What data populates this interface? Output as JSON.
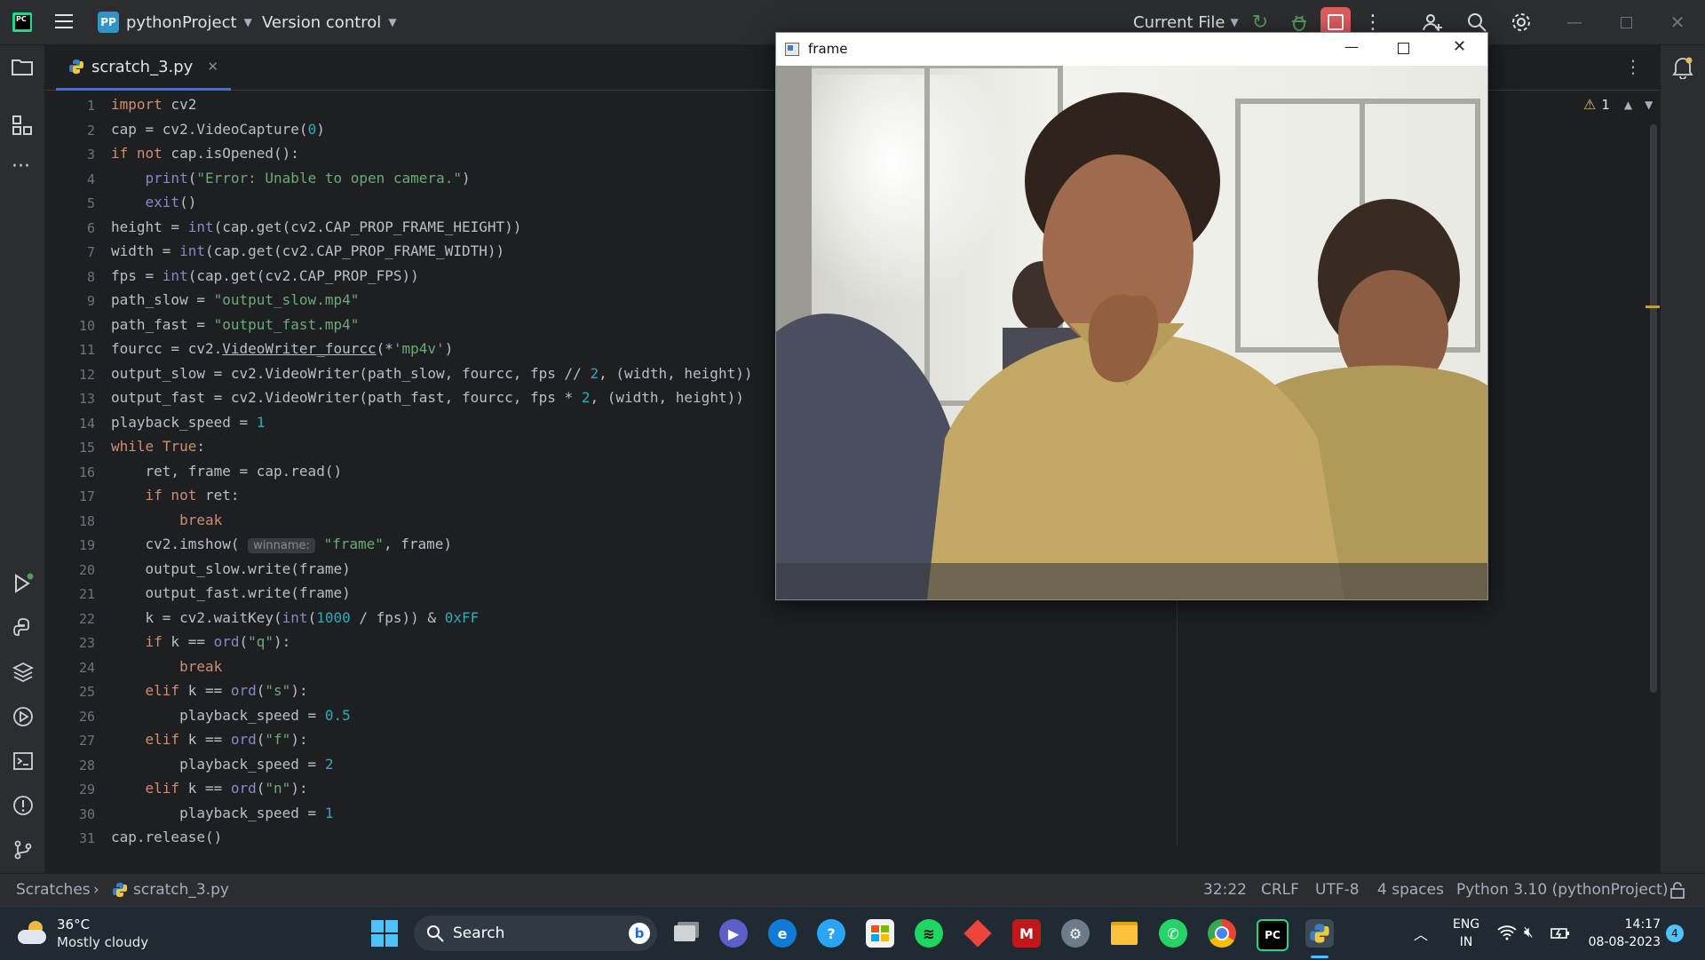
{
  "titlebar": {
    "project_badge": "PP",
    "project_name": "pythonProject",
    "vcs": "Version control",
    "run_config": "Current File"
  },
  "tab": {
    "name": "scratch_3.py"
  },
  "inspection": {
    "warnings": "1"
  },
  "code": [
    [
      {
        "t": "import",
        "c": "kw"
      },
      {
        "t": " cv2"
      }
    ],
    [
      {
        "t": "cap = cv2.VideoCapture("
      },
      {
        "t": "0",
        "c": "num"
      },
      {
        "t": ")"
      }
    ],
    [
      {
        "t": "if not",
        "c": "kw"
      },
      {
        "t": " cap.isOpened():"
      }
    ],
    [
      {
        "t": "    "
      },
      {
        "t": "print",
        "c": "bi"
      },
      {
        "t": "("
      },
      {
        "t": "\"Error: Unable to open camera.\"",
        "c": "str"
      },
      {
        "t": ")"
      }
    ],
    [
      {
        "t": "    "
      },
      {
        "t": "exit",
        "c": "bi"
      },
      {
        "t": "()"
      }
    ],
    [
      {
        "t": "height = "
      },
      {
        "t": "int",
        "c": "bi"
      },
      {
        "t": "(cap.get(cv2.CAP_PROP_FRAME_HEIGHT))"
      }
    ],
    [
      {
        "t": "width = "
      },
      {
        "t": "int",
        "c": "bi"
      },
      {
        "t": "(cap.get(cv2.CAP_PROP_FRAME_WIDTH))"
      }
    ],
    [
      {
        "t": "fps = "
      },
      {
        "t": "int",
        "c": "bi"
      },
      {
        "t": "(cap.get(cv2.CAP_PROP_FPS))"
      }
    ],
    [
      {
        "t": "path_slow = "
      },
      {
        "t": "\"output_slow.mp4\"",
        "c": "str"
      }
    ],
    [
      {
        "t": "path_fast = "
      },
      {
        "t": "\"output_fast.mp4\"",
        "c": "str"
      }
    ],
    [
      {
        "t": "fourcc = cv2."
      },
      {
        "t": "VideoWriter_fourcc",
        "u": true
      },
      {
        "t": "(*"
      },
      {
        "t": "'mp4v'",
        "c": "str"
      },
      {
        "t": ")"
      }
    ],
    [
      {
        "t": "output_slow = cv2.VideoWriter(path_slow, fourcc, fps // "
      },
      {
        "t": "2",
        "c": "num"
      },
      {
        "t": ", (width, height))"
      }
    ],
    [
      {
        "t": "output_fast = cv2.VideoWriter(path_fast, fourcc, fps * "
      },
      {
        "t": "2",
        "c": "num"
      },
      {
        "t": ", (width, height))"
      }
    ],
    [
      {
        "t": "playback_speed = "
      },
      {
        "t": "1",
        "c": "num"
      }
    ],
    [
      {
        "t": "while",
        "c": "kw"
      },
      {
        "t": " "
      },
      {
        "t": "True",
        "c": "kw"
      },
      {
        "t": ":"
      }
    ],
    [
      {
        "t": "    ret, frame = cap.read()"
      }
    ],
    [
      {
        "t": "    "
      },
      {
        "t": "if not",
        "c": "kw"
      },
      {
        "t": " ret:"
      }
    ],
    [
      {
        "t": "        "
      },
      {
        "t": "break",
        "c": "kw"
      }
    ],
    [
      {
        "t": "    cv2.imshow( "
      },
      {
        "t": "winname:",
        "c": "hint"
      },
      {
        "t": " "
      },
      {
        "t": "\"frame\"",
        "c": "str"
      },
      {
        "t": ", frame)"
      }
    ],
    [
      {
        "t": "    output_slow.write(frame)"
      }
    ],
    [
      {
        "t": "    output_fast.write(frame)"
      }
    ],
    [
      {
        "t": "    k = cv2.waitKey("
      },
      {
        "t": "int",
        "c": "bi"
      },
      {
        "t": "("
      },
      {
        "t": "1000",
        "c": "num"
      },
      {
        "t": " / fps)) & "
      },
      {
        "t": "0xFF",
        "c": "num"
      }
    ],
    [
      {
        "t": "    "
      },
      {
        "t": "if",
        "c": "kw"
      },
      {
        "t": " k == "
      },
      {
        "t": "ord",
        "c": "bi"
      },
      {
        "t": "("
      },
      {
        "t": "\"q\"",
        "c": "str"
      },
      {
        "t": "):"
      }
    ],
    [
      {
        "t": "        "
      },
      {
        "t": "break",
        "c": "kw"
      }
    ],
    [
      {
        "t": "    "
      },
      {
        "t": "elif",
        "c": "kw"
      },
      {
        "t": " k == "
      },
      {
        "t": "ord",
        "c": "bi"
      },
      {
        "t": "("
      },
      {
        "t": "\"s\"",
        "c": "str"
      },
      {
        "t": "):"
      }
    ],
    [
      {
        "t": "        playback_speed = "
      },
      {
        "t": "0.5",
        "c": "num"
      }
    ],
    [
      {
        "t": "    "
      },
      {
        "t": "elif",
        "c": "kw"
      },
      {
        "t": " k == "
      },
      {
        "t": "ord",
        "c": "bi"
      },
      {
        "t": "("
      },
      {
        "t": "\"f\"",
        "c": "str"
      },
      {
        "t": "):"
      }
    ],
    [
      {
        "t": "        playback_speed = "
      },
      {
        "t": "2",
        "c": "num"
      }
    ],
    [
      {
        "t": "    "
      },
      {
        "t": "elif",
        "c": "kw"
      },
      {
        "t": " k == "
      },
      {
        "t": "ord",
        "c": "bi"
      },
      {
        "t": "("
      },
      {
        "t": "\"n\"",
        "c": "str"
      },
      {
        "t": "):"
      }
    ],
    [
      {
        "t": "        playback_speed = "
      },
      {
        "t": "1",
        "c": "num"
      }
    ],
    [
      {
        "t": "cap.release()"
      }
    ]
  ],
  "frame_window": {
    "title": "frame"
  },
  "statusbar": {
    "breadcrumb_root": "Scratches",
    "breadcrumb_file": "scratch_3.py",
    "position": "32:22",
    "line_sep": "CRLF",
    "encoding": "UTF-8",
    "indent": "4 spaces",
    "interpreter": "Python 3.10 (pythonProject)"
  },
  "taskbar": {
    "weather_temp": "36°C",
    "weather_desc": "Mostly cloudy",
    "search_label": "Search",
    "lang_top": "ENG",
    "lang_bottom": "IN",
    "time": "14:17",
    "date": "08-08-2023",
    "notif_count": "4"
  },
  "colors": {
    "accent": "#3574f0",
    "stop": "#db5c5c",
    "run": "#57965c"
  }
}
